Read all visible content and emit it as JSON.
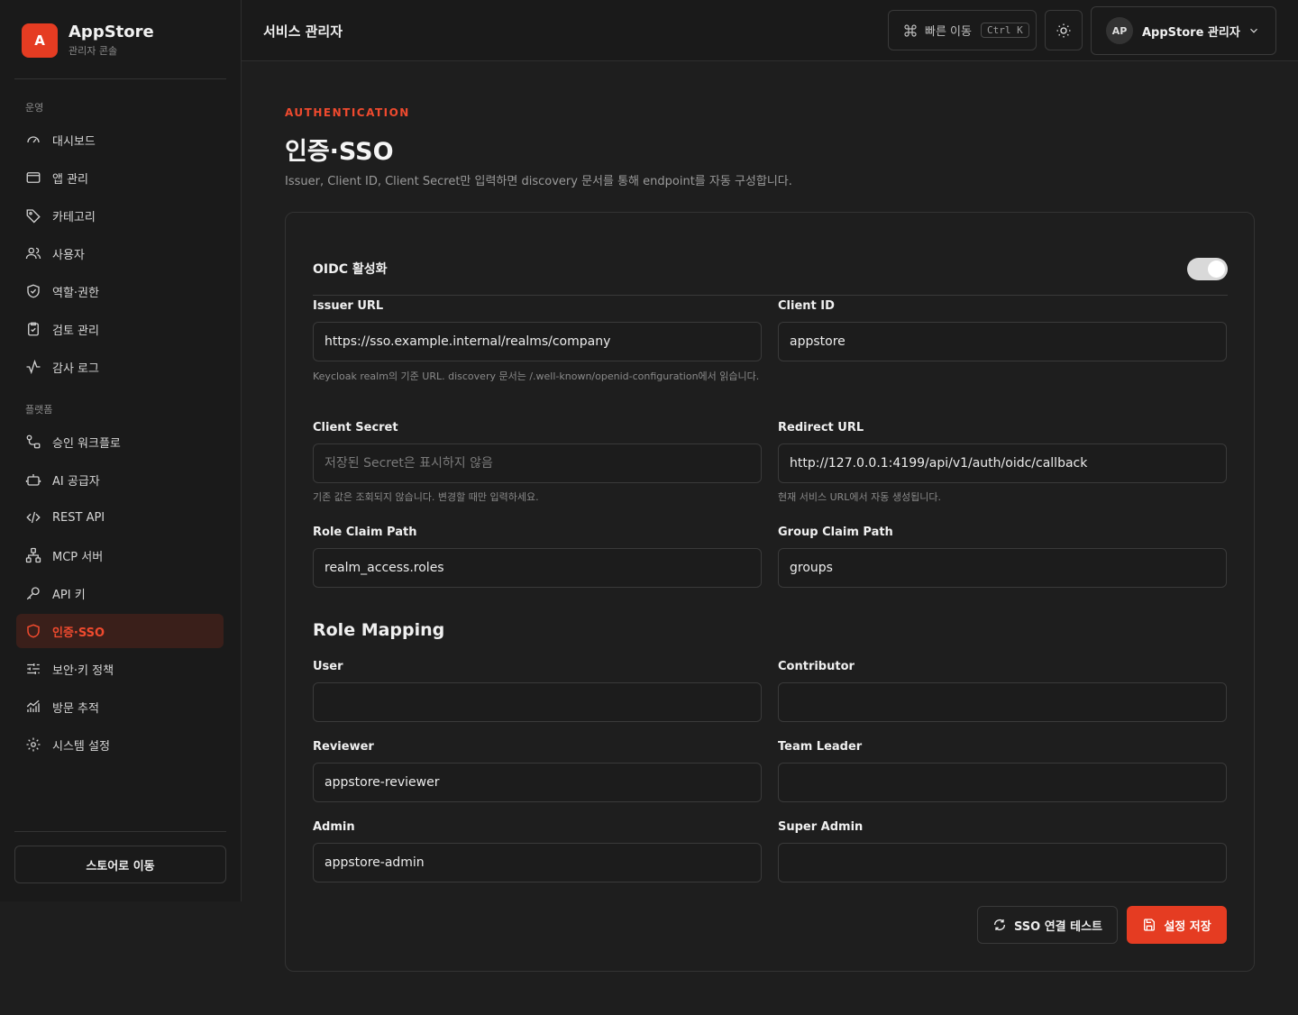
{
  "brand": {
    "logo_letter": "A",
    "name": "AppStore",
    "subtitle": "관리자 콘솔",
    "accent": "#e53c22"
  },
  "sidebar": {
    "sections": [
      {
        "label": "운영",
        "items": [
          {
            "label": "대시보드",
            "icon": "gauge-icon"
          },
          {
            "label": "앱 관리",
            "icon": "window-icon"
          },
          {
            "label": "카테고리",
            "icon": "tag-icon"
          },
          {
            "label": "사용자",
            "icon": "users-icon"
          },
          {
            "label": "역할·권한",
            "icon": "shield-check-icon"
          },
          {
            "label": "검토 관리",
            "icon": "clipboard-check-icon"
          },
          {
            "label": "감사 로그",
            "icon": "activity-icon"
          }
        ]
      },
      {
        "label": "플랫폼",
        "items": [
          {
            "label": "승인 워크플로",
            "icon": "workflow-icon"
          },
          {
            "label": "AI 공급자",
            "icon": "bot-icon"
          },
          {
            "label": "REST API",
            "icon": "code-icon"
          },
          {
            "label": "MCP 서버",
            "icon": "network-icon"
          },
          {
            "label": "API 키",
            "icon": "key-icon"
          },
          {
            "label": "인증·SSO",
            "icon": "shield-icon",
            "active": true
          },
          {
            "label": "보안·키 정책",
            "icon": "sliders-icon"
          },
          {
            "label": "방문 추적",
            "icon": "chart-icon"
          },
          {
            "label": "시스템 설정",
            "icon": "gear-icon"
          }
        ]
      }
    ],
    "store_button": "스토어로 이동"
  },
  "header": {
    "title": "서비스 관리자",
    "quick_nav": "빠른 이동",
    "shortcut": "Ctrl K",
    "user_initials": "AP",
    "user_name": "AppStore 관리자"
  },
  "page": {
    "eyebrow": "AUTHENTICATION",
    "title": "인증·SSO",
    "description": "Issuer, Client ID, Client Secret만 입력하면 discovery 문서를 통해 endpoint를 자동 구성합니다."
  },
  "form": {
    "oidc_label": "OIDC 활성화",
    "oidc_enabled": true,
    "issuer_url": {
      "label": "Issuer URL",
      "value": "https://sso.example.internal/realms/company",
      "hint": "Keycloak realm의 기준 URL. discovery 문서는 /.well-known/openid-configuration에서 읽습니다."
    },
    "client_id": {
      "label": "Client ID",
      "value": "appstore"
    },
    "client_secret": {
      "label": "Client Secret",
      "placeholder": "저장된 Secret은 표시하지 않음",
      "hint": "기존 값은 조회되지 않습니다. 변경할 때만 입력하세요."
    },
    "redirect_url": {
      "label": "Redirect URL",
      "value": "http://127.0.0.1:4199/api/v1/auth/oidc/callback",
      "hint": "현재 서비스 URL에서 자동 생성됩니다."
    },
    "role_claim_path": {
      "label": "Role Claim Path",
      "value": "realm_access.roles"
    },
    "group_claim_path": {
      "label": "Group Claim Path",
      "value": "groups"
    }
  },
  "role_mapping": {
    "title": "Role Mapping",
    "user": {
      "label": "User",
      "value": ""
    },
    "contributor": {
      "label": "Contributor",
      "value": ""
    },
    "reviewer": {
      "label": "Reviewer",
      "value": "appstore-reviewer"
    },
    "team_leader": {
      "label": "Team Leader",
      "value": ""
    },
    "admin": {
      "label": "Admin",
      "value": "appstore-admin"
    },
    "super_admin": {
      "label": "Super Admin",
      "value": ""
    }
  },
  "actions": {
    "test_label": "SSO 연결 테스트",
    "save_label": "설정 저장"
  }
}
